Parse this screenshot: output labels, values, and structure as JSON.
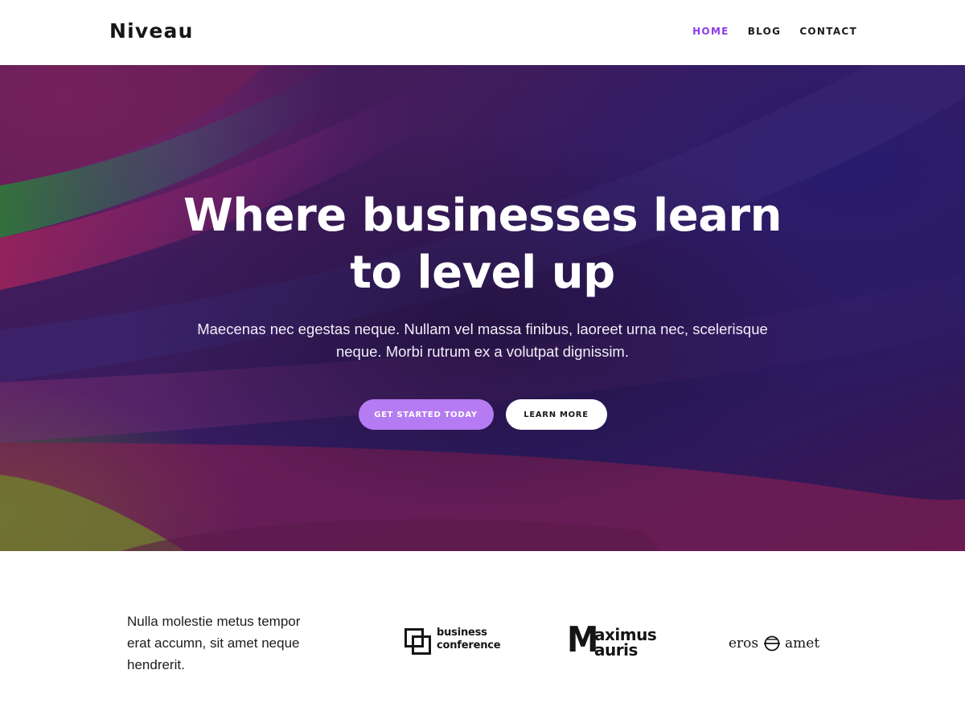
{
  "header": {
    "brand": "Niveau",
    "nav": [
      {
        "label": "HOME",
        "active": true
      },
      {
        "label": "BLOG",
        "active": false
      },
      {
        "label": "CONTACT",
        "active": false
      }
    ],
    "accent_color": "#8b3dea"
  },
  "hero": {
    "title_line1": "Where businesses learn",
    "title_line2": "to level up",
    "subtitle_line1": "Maecenas nec egestas neque. Nullam vel massa finibus, laoreet urna nec, scelerisque",
    "subtitle_line2": "neque. Morbi rutrum ex a volutpat dignissim.",
    "primary_button": "GET STARTED TODAY",
    "secondary_button": "LEARN MORE",
    "primary_button_color": "#b57bf2",
    "background_image": "abstract-colorful-paper-bands"
  },
  "logos": {
    "text_line1": "Nulla molestie metus tempor",
    "text_line2": "erat accumn, sit amet neque",
    "text_line3": "hendrerit.",
    "business_conference": {
      "line1": "business",
      "line2": "conference",
      "icon": "overlapping-squares-icon"
    },
    "maximus_mauris": {
      "letter": "M",
      "line1": "aximus",
      "line2": "auris"
    },
    "eros_amet": {
      "word1": "eros",
      "word2": "amet",
      "icon": "circle-e-icon"
    }
  }
}
